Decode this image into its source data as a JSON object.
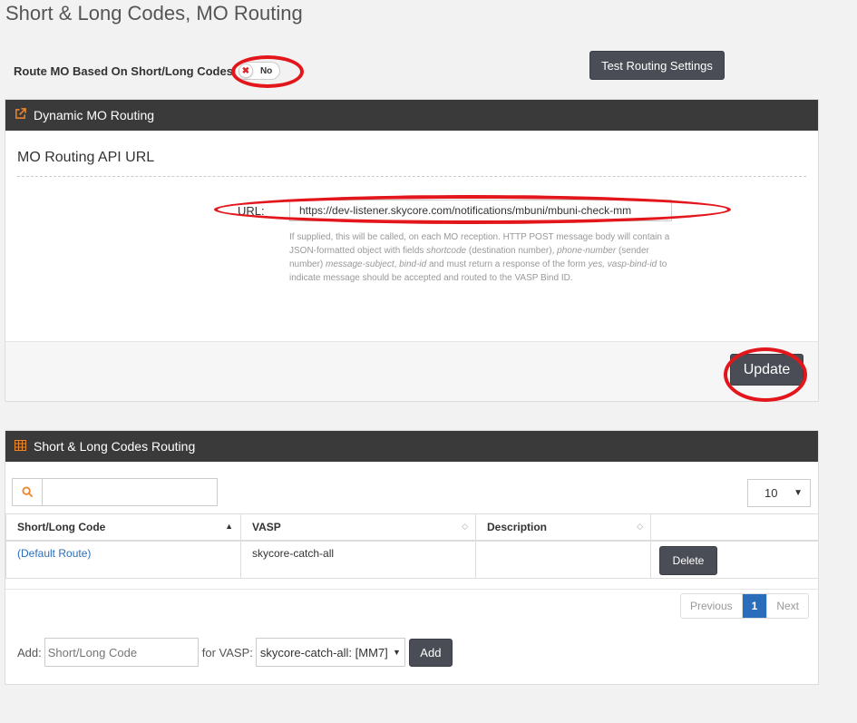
{
  "page": {
    "title": "Short & Long Codes, MO Routing"
  },
  "route_toggle": {
    "label": "Route MO Based On Short/Long Codes",
    "state": "No",
    "knob_icon": "x-icon"
  },
  "test_button": "Test Routing Settings",
  "dynamic_panel": {
    "header": "Dynamic MO Routing",
    "header_icon": "external-link-icon",
    "section_title": "MO Routing API URL",
    "url_label": "URL:",
    "url_value": "https://dev-listener.skycore.com/notifications/mbuni/mbuni-check-mm",
    "help": {
      "p1": "If supplied, this will be called, on each MO reception. HTTP POST message body will contain a JSON-formatted object with fields ",
      "f1": "shortcode",
      "p2": " (destination number), ",
      "f2": "phone-number",
      "p3": " (sender number) ",
      "f3": "message-subject",
      "p4": ", ",
      "f4": "bind-id",
      "p5": " and must return a response of the form ",
      "f5": "yes, vasp-bind-id",
      "p6": " to indicate message should be accepted and routed to the VASP Bind ID."
    },
    "update_button": "Update"
  },
  "codes_panel": {
    "header": "Short & Long Codes Routing",
    "header_icon": "table-icon",
    "search_icon": "search-icon",
    "page_size": "10",
    "columns": [
      "Short/Long Code",
      "VASP",
      "Description",
      ""
    ],
    "rows": [
      {
        "code": "(Default Route)",
        "vasp": "skycore-catch-all",
        "description": "",
        "action": "Delete"
      }
    ],
    "pager": {
      "prev": "Previous",
      "current": "1",
      "next": "Next"
    },
    "add": {
      "label": "Add:",
      "code_placeholder": "Short/Long Code",
      "for_label": "for VASP:",
      "vasp_selected": "skycore-catch-all: [MM7]",
      "button": "Add"
    }
  },
  "colors": {
    "header_bg": "#3a3a3a",
    "icon_accent": "#f0882a",
    "button_bg": "#4a4d55",
    "link": "#2a6ebb",
    "highlight": "#e3161b"
  }
}
